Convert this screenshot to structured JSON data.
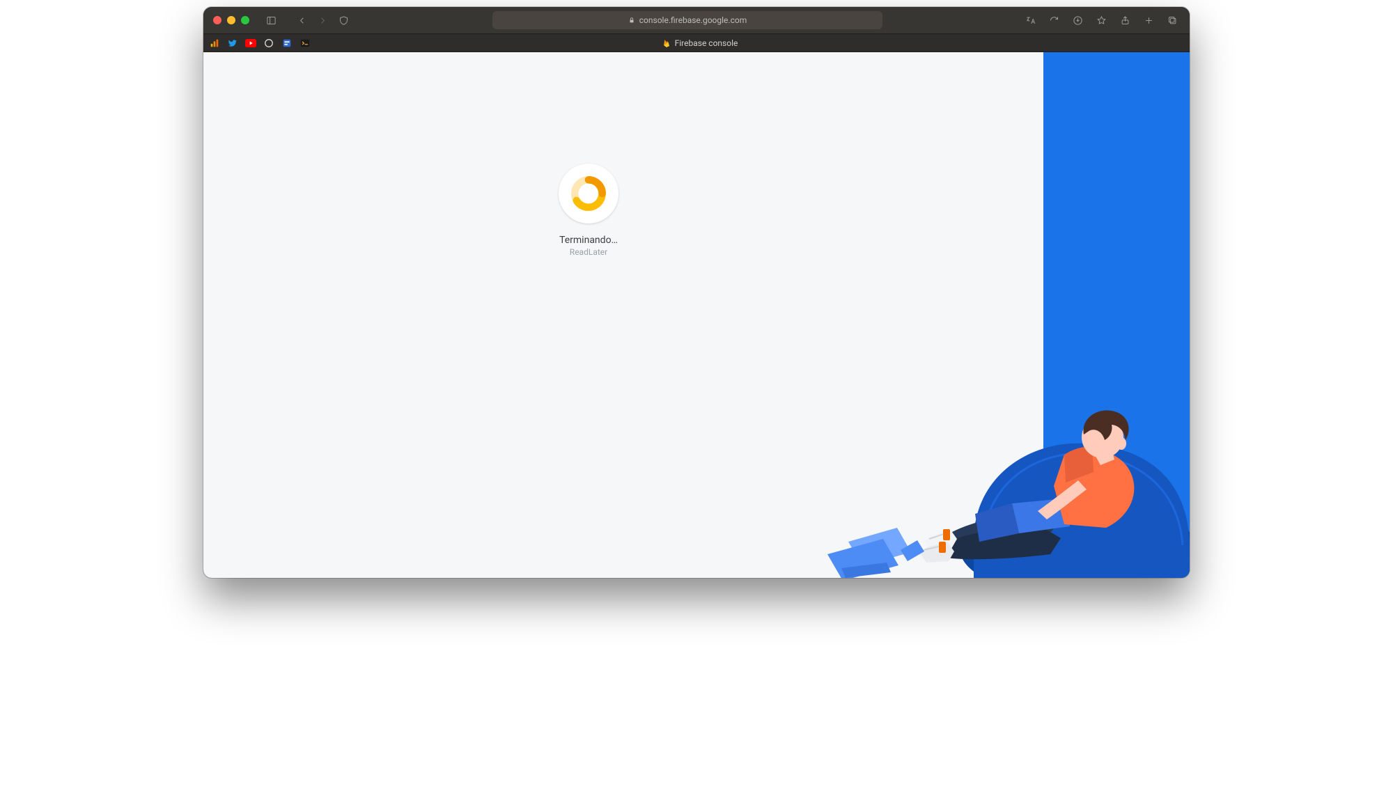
{
  "browser": {
    "url": "console.firebase.google.com",
    "tab_title": "Firebase console"
  },
  "favorites": [
    {
      "name": "analytics-icon"
    },
    {
      "name": "twitter-icon"
    },
    {
      "name": "youtube-icon"
    },
    {
      "name": "circle-icon"
    },
    {
      "name": "app-icon"
    },
    {
      "name": "terminal-icon"
    }
  ],
  "loading": {
    "status": "Terminando…",
    "project": "ReadLater"
  },
  "colors": {
    "accent_blue": "#1a73e8",
    "spinner_orange": "#f5a623",
    "spinner_amber": "#fbbc04"
  }
}
